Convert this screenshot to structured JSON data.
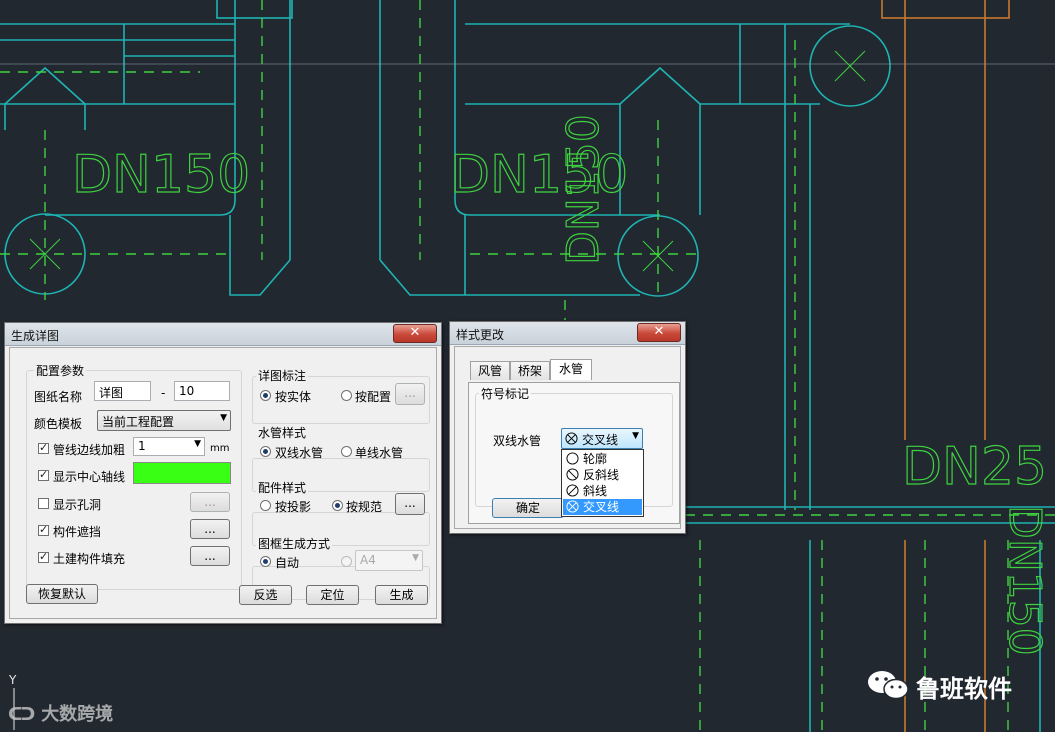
{
  "cad": {
    "pipe_labels": [
      "DN150",
      "DN150",
      "DN150",
      "DN25",
      "DN150"
    ],
    "axis_label": "Y"
  },
  "dialog_detail": {
    "title": "生成详图",
    "close_glyph": "✕",
    "config_group": "配置参数",
    "drawing_name_label": "图纸名称",
    "drawing_name_value": "详图",
    "dash": "-",
    "drawing_number_value": "10",
    "color_template_label": "颜色模板",
    "color_template_value": "当前工程配置",
    "options": [
      {
        "label": "管线边线加粗",
        "checked": true
      },
      {
        "label": "显示中心轴线",
        "checked": true
      },
      {
        "label": "显示孔洞",
        "checked": false
      },
      {
        "label": "构件遮挡",
        "checked": true
      },
      {
        "label": "土建构件填充",
        "checked": true
      }
    ],
    "thickness_value": "1",
    "thickness_unit": "mm",
    "axis_color": "#39ff14",
    "ellipsis": "...",
    "detail_label_group": "详图标注",
    "detail_label_options": [
      "按实体",
      "按配置"
    ],
    "water_style_group": "水管样式",
    "water_style_options": [
      "双线水管",
      "单线水管"
    ],
    "fitting_style_group": "配件样式",
    "fitting_style_options": [
      "按投影",
      "按规范"
    ],
    "frame_group": "图框生成方式",
    "frame_options": [
      "自动",
      ""
    ],
    "paper_size": "A4",
    "btn_restore": "恢复默认",
    "btn_invert": "反选",
    "btn_locate": "定位",
    "btn_generate": "生成"
  },
  "dialog_style": {
    "title": "样式更改",
    "close_glyph": "✕",
    "tabs": [
      "风管",
      "桥架",
      "水管"
    ],
    "active_tab": "水管",
    "symbol_group": "符号标记",
    "double_pipe_label": "双线水管",
    "selected_symbol": "交叉线",
    "list_items": [
      "轮廓",
      "反斜线",
      "斜线",
      "交叉线"
    ],
    "ok_button": "确定"
  },
  "watermarks": {
    "left": "大数跨境",
    "right": "鲁班软件"
  },
  "colors": {
    "background": "#212830",
    "pipe_cyan": "#1fb3b3",
    "label_green": "#3fd13f",
    "orange": "#c8782e",
    "selection": "#3399ff"
  }
}
